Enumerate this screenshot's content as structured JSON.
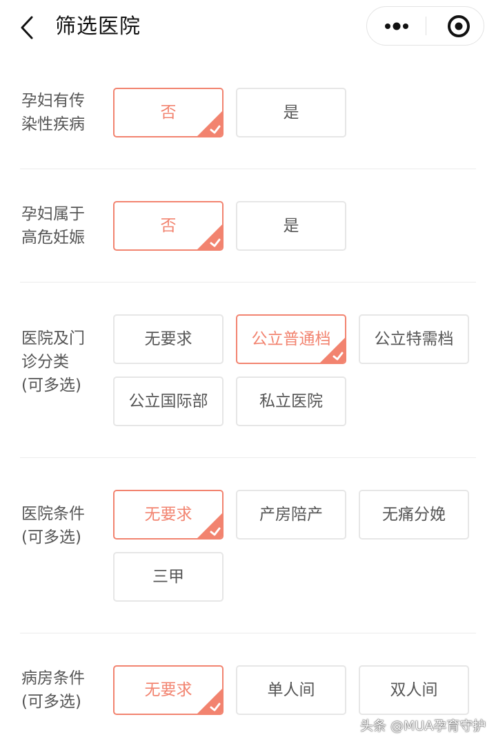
{
  "header": {
    "title": "筛选医院",
    "back_icon": "chevron-left-icon",
    "more_icon": "more-dots-icon",
    "close_icon": "target-circle-icon"
  },
  "colors": {
    "accent": "#f2836f",
    "border": "#e6e6e6",
    "text": "#555555"
  },
  "sections": [
    {
      "label_lines": [
        "孕妇有传",
        "染性疾病"
      ],
      "options": [
        {
          "label": "否",
          "selected": true
        },
        {
          "label": "是",
          "selected": false
        }
      ]
    },
    {
      "label_lines": [
        "孕妇属于",
        "高危妊娠"
      ],
      "options": [
        {
          "label": "否",
          "selected": true
        },
        {
          "label": "是",
          "selected": false
        }
      ]
    },
    {
      "label_lines": [
        "医院及门",
        "诊分类",
        "(可多选)"
      ],
      "options": [
        {
          "label": "无要求",
          "selected": false
        },
        {
          "label": "公立普通档",
          "selected": true
        },
        {
          "label": "公立特需档",
          "selected": false
        },
        {
          "label": "公立国际部",
          "selected": false
        },
        {
          "label": "私立医院",
          "selected": false
        }
      ]
    },
    {
      "label_lines": [
        "医院条件",
        "(可多选)"
      ],
      "options": [
        {
          "label": "无要求",
          "selected": true
        },
        {
          "label": "产房陪产",
          "selected": false
        },
        {
          "label": "无痛分娩",
          "selected": false
        },
        {
          "label": "三甲",
          "selected": false
        }
      ]
    },
    {
      "label_lines": [
        "病房条件",
        "(可多选)"
      ],
      "options": [
        {
          "label": "无要求",
          "selected": true
        },
        {
          "label": "单人间",
          "selected": false
        },
        {
          "label": "双人间",
          "selected": false
        }
      ]
    }
  ],
  "watermark": "头条 @MUA孕育守护"
}
